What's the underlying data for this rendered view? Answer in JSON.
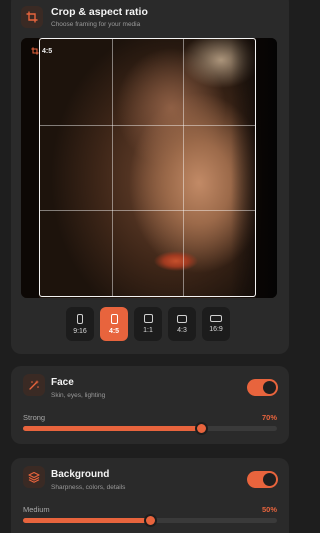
{
  "crop": {
    "title": "Crop & aspect ratio",
    "subtitle": "Choose framing for your media",
    "current_ratio": "4:5",
    "icon": "crop-icon",
    "ratios": [
      {
        "label": "9:16",
        "active": false,
        "icon": "portrait-tall-icon"
      },
      {
        "label": "4:5",
        "active": true,
        "icon": "portrait-icon"
      },
      {
        "label": "1:1",
        "active": false,
        "icon": "square-icon"
      },
      {
        "label": "4:3",
        "active": false,
        "icon": "landscape-icon"
      },
      {
        "label": "16:9",
        "active": false,
        "icon": "landscape-wide-icon"
      }
    ]
  },
  "face": {
    "title": "Face",
    "subtitle": "Skin, eyes, lighting",
    "icon": "magic-wand-icon",
    "enabled": true,
    "level_label": "Strong",
    "percent_text": "70%",
    "value": 0.7
  },
  "background": {
    "title": "Background",
    "subtitle": "Sharpness, colors, details",
    "icon": "layers-icon",
    "enabled": true,
    "level_label": "Medium",
    "percent_text": "50%",
    "value": 0.5
  },
  "colors": {
    "accent": "#e8643d",
    "card": "#2a2a2a",
    "page": "#1e1e1e"
  }
}
